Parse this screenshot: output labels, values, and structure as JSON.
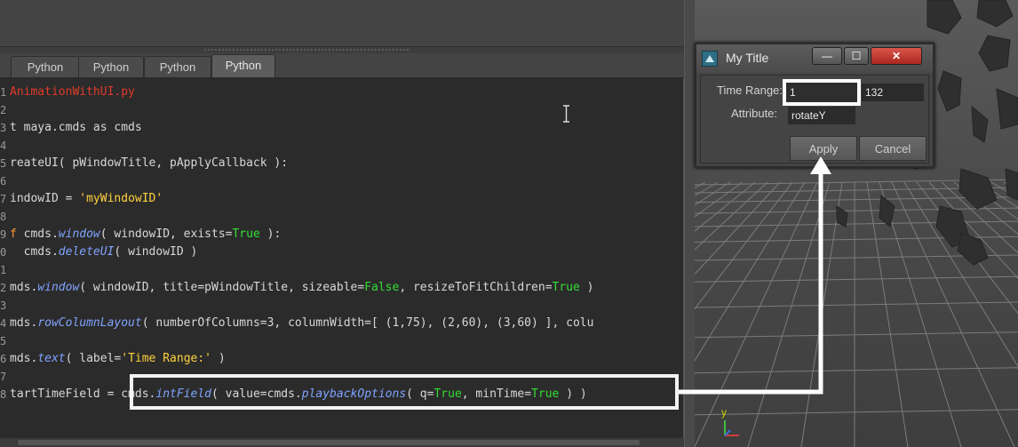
{
  "editor": {
    "tabs": [
      "Python",
      "Python",
      "Python",
      "Python"
    ],
    "active_tab": 3,
    "lines": [
      {
        "n": "1",
        "segments": [
          {
            "t": "AnimationWithUI.py",
            "c": "red"
          }
        ]
      },
      {
        "n": "2",
        "segments": []
      },
      {
        "n": "3",
        "segments": [
          {
            "t": "t maya.cmds as cmds",
            "c": ""
          }
        ]
      },
      {
        "n": "4",
        "segments": []
      },
      {
        "n": "5",
        "segments": [
          {
            "t": "reateUI( pWindowTitle, pApplyCallback ):",
            "c": ""
          }
        ]
      },
      {
        "n": "6",
        "segments": []
      },
      {
        "n": "7",
        "segments": [
          {
            "t": "indowID = ",
            "c": ""
          },
          {
            "t": "'myWindowID'",
            "c": "str"
          }
        ]
      },
      {
        "n": "8",
        "segments": []
      },
      {
        "n": "9",
        "segments": [
          {
            "t": "f",
            "c": "kw"
          },
          {
            "t": " cmds.",
            "c": ""
          },
          {
            "t": "window",
            "c": "fn"
          },
          {
            "t": "( windowID, exists=",
            "c": ""
          },
          {
            "t": "True",
            "c": "bool"
          },
          {
            "t": " ):",
            "c": ""
          }
        ]
      },
      {
        "n": "0",
        "segments": [
          {
            "t": "  cmds.",
            "c": ""
          },
          {
            "t": "deleteUI",
            "c": "fn"
          },
          {
            "t": "( windowID )",
            "c": ""
          }
        ]
      },
      {
        "n": "1",
        "segments": []
      },
      {
        "n": "2",
        "segments": [
          {
            "t": "mds.",
            "c": ""
          },
          {
            "t": "window",
            "c": "fn"
          },
          {
            "t": "( windowID, title=pWindowTitle, sizeable=",
            "c": ""
          },
          {
            "t": "False",
            "c": "bool"
          },
          {
            "t": ", resizeToFitChildren=",
            "c": ""
          },
          {
            "t": "True",
            "c": "bool"
          },
          {
            "t": " )",
            "c": ""
          }
        ]
      },
      {
        "n": "3",
        "segments": []
      },
      {
        "n": "4",
        "segments": [
          {
            "t": "mds.",
            "c": ""
          },
          {
            "t": "rowColumnLayout",
            "c": "fn"
          },
          {
            "t": "( numberOfColumns=3, columnWidth=[ (1,75), (2,60), (3,60) ], colu",
            "c": ""
          }
        ]
      },
      {
        "n": "5",
        "segments": []
      },
      {
        "n": "6",
        "segments": [
          {
            "t": "mds.",
            "c": ""
          },
          {
            "t": "text",
            "c": "fn"
          },
          {
            "t": "( label=",
            "c": ""
          },
          {
            "t": "'Time Range:'",
            "c": "str"
          },
          {
            "t": " )",
            "c": ""
          }
        ]
      },
      {
        "n": "7",
        "segments": []
      },
      {
        "n": "8",
        "segments": [
          {
            "t": "tartTimeField = ",
            "c": ""
          },
          {
            "t": "cmds.",
            "c": ""
          },
          {
            "t": "intField",
            "c": "fn"
          },
          {
            "t": "( value=cmds.",
            "c": ""
          },
          {
            "t": "playbackOptions",
            "c": "fn"
          },
          {
            "t": "( q=",
            "c": ""
          },
          {
            "t": "True",
            "c": "bool"
          },
          {
            "t": ", minTime=",
            "c": ""
          },
          {
            "t": "True",
            "c": "bool"
          },
          {
            "t": " ) )",
            "c": ""
          }
        ]
      }
    ]
  },
  "dialog": {
    "title": "My Title",
    "minimize_label": "—",
    "maximize_label": "☐",
    "close_label": "✕",
    "time_range_label": "Time Range:",
    "start_value": "1",
    "end_value": "132",
    "attribute_label": "Attribute:",
    "attribute_value": "rotateY",
    "apply_label": "Apply",
    "cancel_label": "Cancel"
  },
  "viewport": {
    "axis_y_label": "y",
    "axis_x_label": "x"
  },
  "colors": {
    "string": "#ffd23f",
    "function": "#7fa3ff",
    "boolean": "#33dd33",
    "keyword": "#ff9933",
    "filename": "#e03b2a",
    "highlight": "#ffffff"
  }
}
